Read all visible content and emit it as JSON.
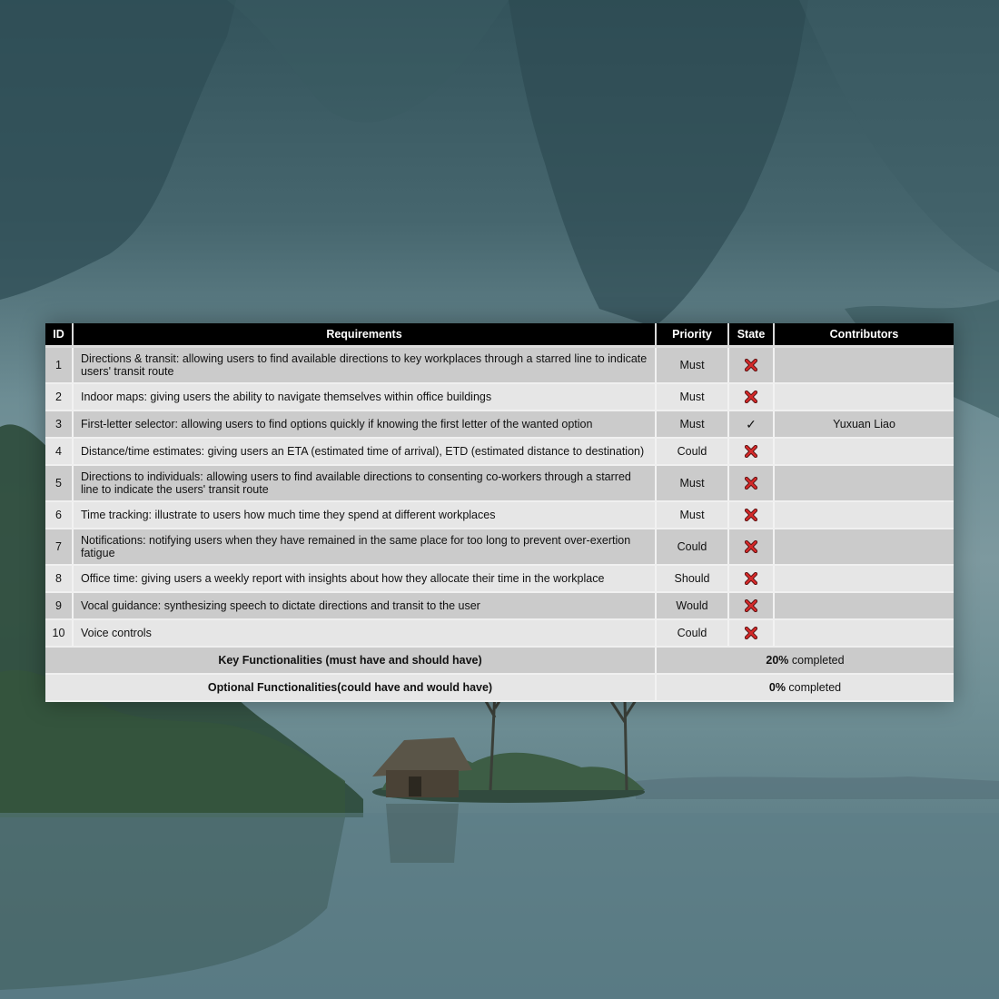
{
  "table": {
    "headers": {
      "id": "ID",
      "requirements": "Requirements",
      "priority": "Priority",
      "state": "State",
      "contributors": "Contributors"
    },
    "rows": [
      {
        "id": "1",
        "requirement": "Directions & transit: allowing users to find available directions to key workplaces through a starred line to indicate users' transit route",
        "priority": "Must",
        "state": "not-done",
        "contributor": ""
      },
      {
        "id": "2",
        "requirement": "Indoor maps: giving users the ability to navigate themselves within office buildings",
        "priority": "Must",
        "state": "not-done",
        "contributor": ""
      },
      {
        "id": "3",
        "requirement": "First-letter selector: allowing users to find options quickly if knowing the first letter of the wanted option",
        "priority": "Must",
        "state": "done",
        "contributor": "Yuxuan Liao"
      },
      {
        "id": "4",
        "requirement": "Distance/time estimates: giving users an ETA (estimated time of arrival), ETD (estimated distance to destination)",
        "priority": "Could",
        "state": "not-done",
        "contributor": ""
      },
      {
        "id": "5",
        "requirement": "Directions to individuals: allowing users to find available directions to consenting co-workers through a starred line to indicate the users' transit route",
        "priority": "Must",
        "state": "not-done",
        "contributor": ""
      },
      {
        "id": "6",
        "requirement": "Time tracking: illustrate to users how much time they spend at different workplaces",
        "priority": "Must",
        "state": "not-done",
        "contributor": ""
      },
      {
        "id": "7",
        "requirement": "Notifications: notifying users when they have remained in the same place for too long to prevent over-exertion fatigue",
        "priority": "Could",
        "state": "not-done",
        "contributor": ""
      },
      {
        "id": "8",
        "requirement": "Office time: giving users a weekly report with insights about how they allocate their time in the workplace",
        "priority": "Should",
        "state": "not-done",
        "contributor": ""
      },
      {
        "id": "9",
        "requirement": "Vocal guidance: synthesizing speech to dictate directions and transit to the user",
        "priority": "Would",
        "state": "not-done",
        "contributor": ""
      },
      {
        "id": "10",
        "requirement": "Voice controls",
        "priority": "Could",
        "state": "not-done",
        "contributor": ""
      }
    ],
    "check_glyph": "✓",
    "summary": [
      {
        "label": "Key Functionalities (must have and should have)",
        "percent": "20%",
        "suffix": " completed"
      },
      {
        "label": "Optional Functionalities(could have and would have)",
        "percent": "0%",
        "suffix": " completed"
      }
    ]
  },
  "colors": {
    "header_bg": "#000000",
    "row_dark": "#cbcbcb",
    "row_light": "#e6e6e6",
    "cross_red": "#d42a2a"
  },
  "icons": {
    "not_done": "red-x-icon",
    "done": "checkmark-icon"
  }
}
